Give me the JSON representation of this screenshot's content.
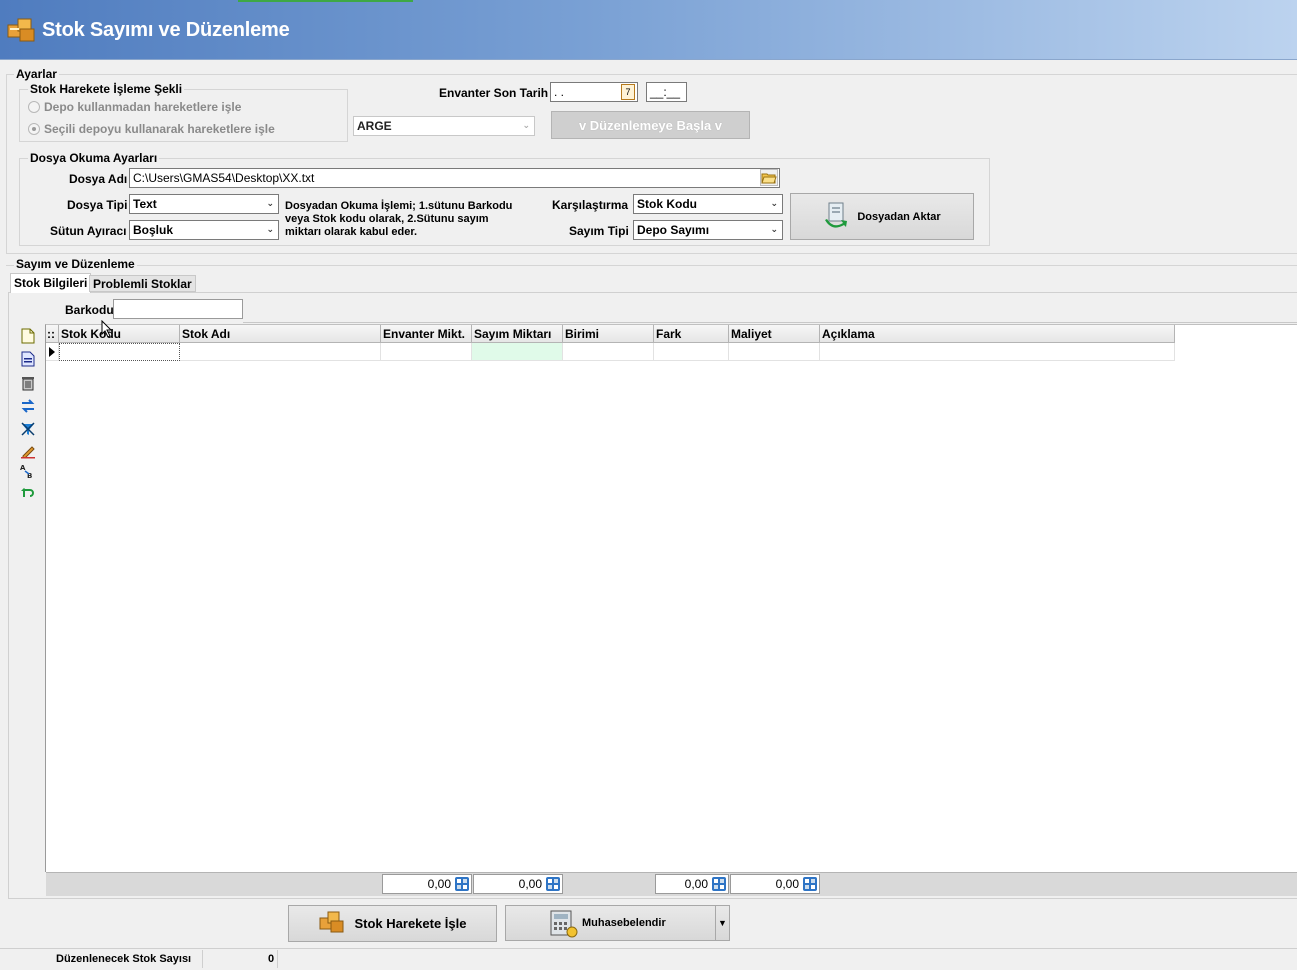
{
  "window": {
    "title": "Stok Sayımı ve Düzenleme"
  },
  "ayarlar": {
    "legend": "Ayarlar",
    "stok_hareket": {
      "legend": "Stok Harekete İşleme Şekli",
      "option1": "Depo kullanmadan hareketlere işle",
      "option2": "Seçili depoyu kullanarak hareketlere işle",
      "selected": 2
    },
    "envanter_label": "Envanter Son Tarih",
    "envanter_date": " . .",
    "envanter_time": "__:__",
    "depo_value": "ARGE",
    "start_button": "v Düzenlemeye Başla v"
  },
  "dosya": {
    "legend": "Dosya Okuma Ayarları",
    "dosya_adi_label": "Dosya Adı",
    "dosya_adi_value": "C:\\Users\\GMAS54\\Desktop\\XX.txt",
    "dosya_tipi_label": "Dosya Tipi",
    "dosya_tipi_value": "Text",
    "sutun_label": "Sütun Ayıracı",
    "sutun_value": "Boşluk",
    "info": "Dosyadan Okuma İşlemi; 1.sütunu Barkodu veya Stok kodu olarak, 2.Sütunu sayım miktarı olarak kabul eder.",
    "karsilastirma_label": "Karşılaştırma",
    "karsilastirma_value": "Stok Kodu",
    "sayim_tipi_label": "Sayım Tipi",
    "sayim_tipi_value": "Depo Sayımı",
    "aktar_button": "Dosyadan Aktar"
  },
  "sayim": {
    "legend": "Sayım ve Düzenleme",
    "tabs": [
      "Stok Bilgileri",
      "Problemli Stoklar"
    ],
    "barkod_label": "Barkodu",
    "columns": [
      "Stok Kodu",
      "Stok Adı",
      "Envanter Mikt.",
      "Sayım Miktarı",
      "Birimi",
      "Fark",
      "Maliyet",
      "Açıklama"
    ],
    "totals": [
      "0,00",
      "0,00",
      "0,00",
      "0,00"
    ]
  },
  "actions": {
    "stok_harekete": "Stok Harekete İşle",
    "muhasebe": "Muhasebelendir"
  },
  "status": {
    "label": "Düzenlenecek Stok Sayısı",
    "value": "0"
  },
  "colors": {
    "title_start": "#4f7cbf",
    "title_end": "#bcd3ef",
    "sayim_cell": "#e0fae9"
  }
}
